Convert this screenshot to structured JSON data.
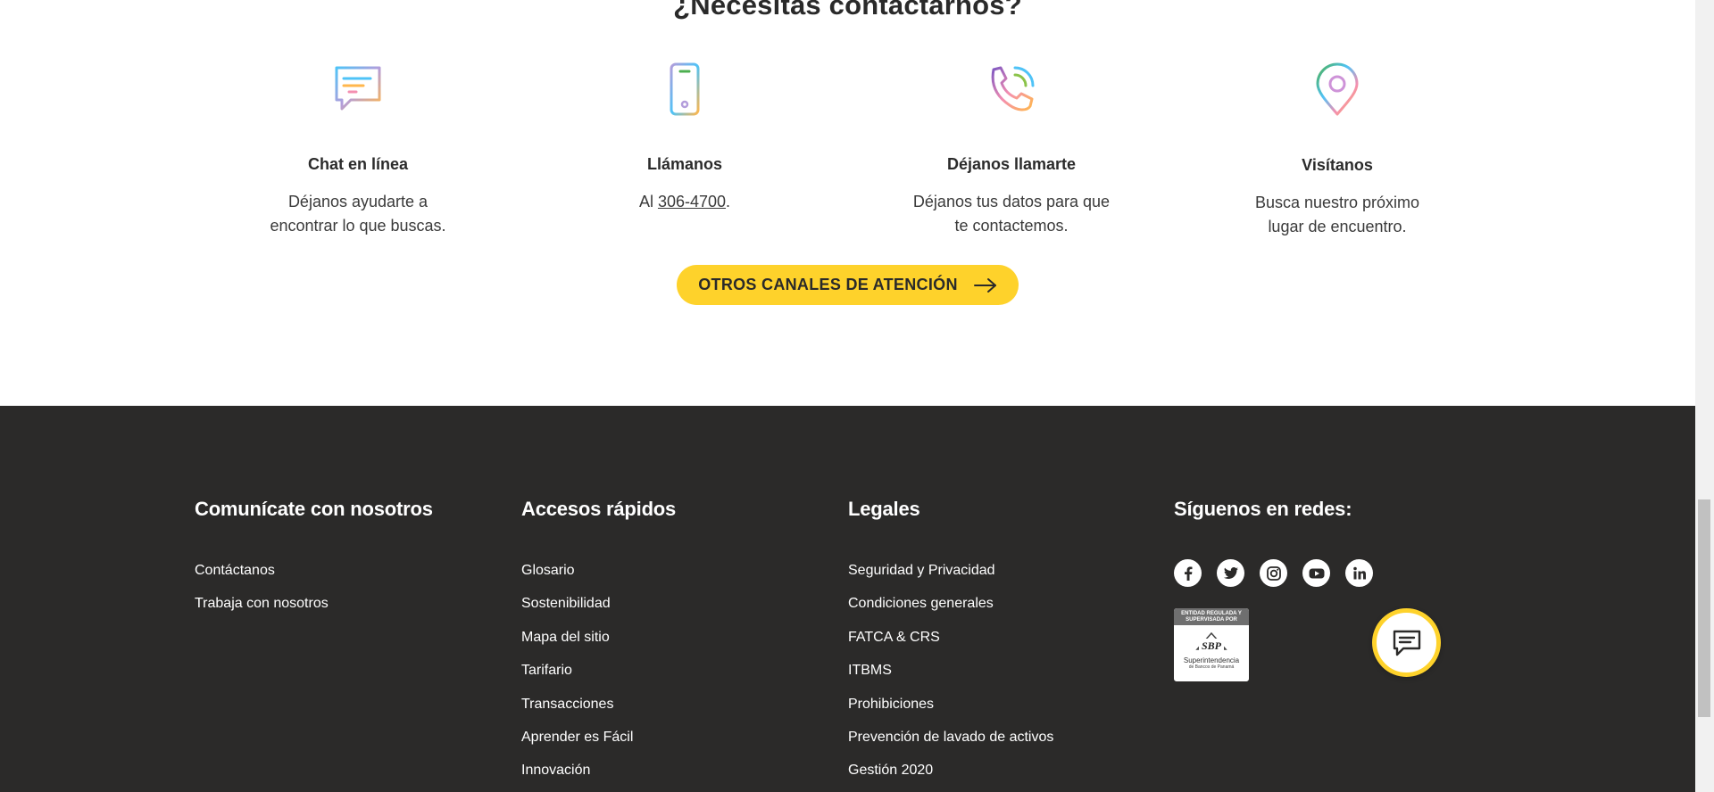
{
  "contact": {
    "title": "¿Necesitas contactarnos?",
    "cards": [
      {
        "icon": "chat-bubble-icon",
        "heading": "Chat en línea",
        "line1": "Déjanos ayudarte a",
        "line2": "encontrar lo que buscas."
      },
      {
        "icon": "phone-icon",
        "heading": "Llámanos",
        "prefix": "Al ",
        "link": "306-4700",
        "suffix": "."
      },
      {
        "icon": "callback-phone-icon",
        "heading": "Déjanos llamarte",
        "line1": "Déjanos tus datos para que",
        "line2": "te contactemos."
      },
      {
        "icon": "location-pin-icon",
        "heading": "Visítanos",
        "line1": "Busca nuestro próximo",
        "line2": "lugar de encuentro."
      }
    ],
    "cta_label": "OTROS CANALES DE ATENCIÓN",
    "accent": "#fed22b"
  },
  "footer": {
    "background": "#2b2a29",
    "col1": {
      "heading": "Comunícate con nosotros",
      "links": [
        "Contáctanos",
        "Trabaja con nosotros"
      ]
    },
    "col2": {
      "heading": "Accesos rápidos",
      "links": [
        "Glosario",
        "Sostenibilidad",
        "Mapa del sitio",
        "Tarifario",
        "Transacciones",
        "Aprender es Fácil",
        "Innovación"
      ]
    },
    "col3": {
      "heading": "Legales",
      "links": [
        "Seguridad y Privacidad",
        "Condiciones generales",
        "FATCA & CRS",
        "ITBMS",
        "Prohibiciones",
        "Prevención de lavado de activos",
        "Gestión 2020"
      ]
    },
    "col4": {
      "heading": "Síguenos en redes:",
      "socials": [
        "facebook-icon",
        "twitter-icon",
        "instagram-icon",
        "youtube-icon",
        "linkedin-icon"
      ],
      "badge": {
        "top_text": "ENTIDAD REGULADA Y SUPERVISADA POR",
        "logo_text": "SBP",
        "name": "Superintendencia",
        "sub": "de Bancos de Panamá"
      }
    }
  }
}
